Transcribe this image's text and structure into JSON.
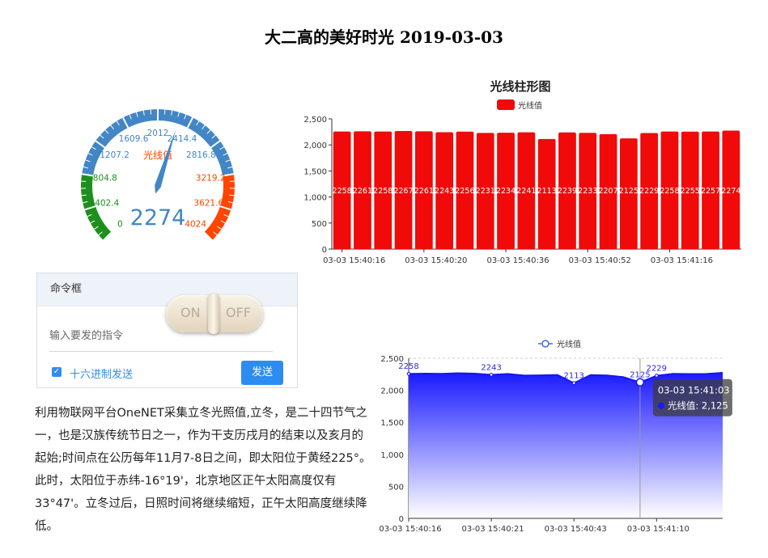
{
  "page": {
    "title": "大二高的美好时光 2019-03-03"
  },
  "gauge": {
    "name": "光线值",
    "value": 2274,
    "min": 0,
    "max": 4024,
    "tick_labels": [
      "0",
      "402.4",
      "804.8",
      "1207.2",
      "1609.6",
      "2012",
      "2414.4",
      "2816.8",
      "3219.2",
      "3621.6",
      "4024"
    ],
    "value_label": "2274",
    "colors": {
      "low": "#1e8f1e",
      "mid": "#4286c5",
      "high": "#ff4500",
      "pointer": "#4286c5"
    }
  },
  "command_box": {
    "title": "命令框",
    "input_placeholder": "输入要发的指令",
    "hex_label": "十六进制发送",
    "hex_checked": true,
    "send_label": "发送",
    "toggle_on_label": "ON",
    "toggle_off_label": "OFF"
  },
  "description": {
    "text": "利用物联网平台OneNET采集立冬光照值,立冬，是二十四节气之一，也是汉族传统节日之一，作为干支历戌月的结束以及亥月的起始;时间点在公历每年11月7-8日之间，即太阳位于黄经225°。此时，太阳位于赤纬-16°19'，北京地区正午太阳高度仅有33°47'。立冬过后，日照时间将继续缩短，正午太阳高度继续降低。"
  },
  "chart_data": [
    {
      "type": "bar",
      "title": "光线柱形图",
      "series": [
        {
          "name": "光线值",
          "values": [
            2258,
            2261,
            2258,
            2267,
            2261,
            2243,
            2256,
            2231,
            2234,
            2241,
            2113,
            2239,
            2233,
            2207,
            2125,
            2229,
            2258,
            2255,
            2257,
            2274
          ]
        }
      ],
      "x_tick_labels": [
        "03-03 15:40:16",
        "03-03 15:40:20",
        "03-03 15:40:36",
        "03-03 15:40:52",
        "03-03 15:41:16"
      ],
      "ylim": [
        0,
        2500
      ],
      "y_ticks": [
        0,
        500,
        1000,
        1500,
        2000,
        2500
      ],
      "y_tick_labels": [
        "0",
        "500",
        "1,000",
        "1,500",
        "2,000",
        "2,500"
      ],
      "legend": "top-center",
      "color": "#f00a0a"
    },
    {
      "type": "area",
      "series": [
        {
          "name": "光线值",
          "values": [
            2258,
            2261,
            2258,
            2267,
            2261,
            2243,
            2256,
            2231,
            2234,
            2241,
            2113,
            2239,
            2233,
            2207,
            2125,
            2229,
            2258,
            2255,
            2257,
            2274
          ]
        }
      ],
      "point_labels": [
        {
          "index": 0,
          "text": "2258"
        },
        {
          "index": 5,
          "text": "2243"
        },
        {
          "index": 10,
          "text": "2113"
        },
        {
          "index": 14,
          "text": "2125"
        },
        {
          "index": 15,
          "text": "2229"
        }
      ],
      "x_tick_labels": [
        "03-03 15:40:16",
        "03-03 15:40:21",
        "03-03 15:40:43",
        "03-03 15:41:10"
      ],
      "ylim": [
        0,
        2500
      ],
      "y_ticks": [
        0,
        500,
        1000,
        1500,
        2000,
        2500
      ],
      "y_tick_labels": [
        "0",
        "500",
        "1,000",
        "1,500",
        "2,000",
        "2,500"
      ],
      "legend": "top-center",
      "color": "#1a1aff",
      "tooltip": {
        "index": 14,
        "title": "03-03 15:41:03",
        "label": "光线值: 2,125"
      }
    }
  ]
}
